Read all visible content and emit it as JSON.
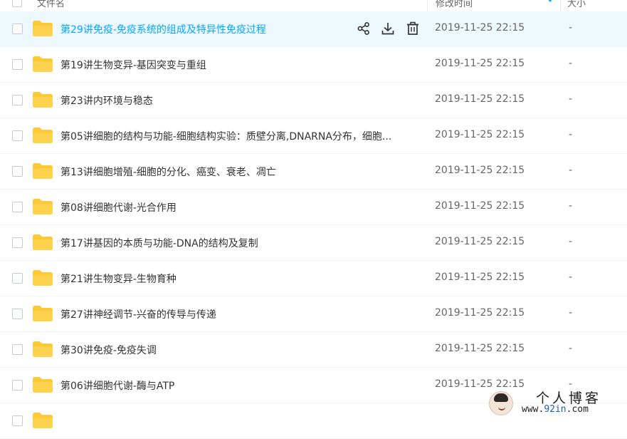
{
  "header": {
    "name_label": "文件名",
    "time_label": "修改时间",
    "size_label": "大小"
  },
  "rows": [
    {
      "name": "第29讲免疫-免疫系统的组成及特异性免疫过程",
      "time": "2019-11-25 22:15",
      "size": "-"
    },
    {
      "name": "第19讲生物变异-基因突变与重组",
      "time": "2019-11-25 22:15",
      "size": "-"
    },
    {
      "name": "第23讲内环境与稳态",
      "time": "2019-11-25 22:15",
      "size": "-"
    },
    {
      "name": "第05讲细胞的结构与功能-细胞结构实验：质壁分离,DNARNA分布，细胞...",
      "time": "2019-11-25 22:15",
      "size": "-"
    },
    {
      "name": "第13讲细胞增殖-细胞的分化、癌变、衰老、凋亡",
      "time": "2019-11-25 22:15",
      "size": "-"
    },
    {
      "name": "第08讲细胞代谢-光合作用",
      "time": "2019-11-25 22:15",
      "size": "-"
    },
    {
      "name": "第17讲基因的本质与功能-DNA的结构及复制",
      "time": "2019-11-25 22:15",
      "size": "-"
    },
    {
      "name": "第21讲生物变异-生物育种",
      "time": "2019-11-25 22:15",
      "size": "-"
    },
    {
      "name": "第27讲神经调节-兴奋的传导与传递",
      "time": "2019-11-25 22:15",
      "size": "-"
    },
    {
      "name": "第30讲免疫-免疫失调",
      "time": "2019-11-25 22:15",
      "size": "-"
    },
    {
      "name": "第06讲细胞代谢-酶与ATP",
      "time": "2019-11-25 22:15",
      "size": "-"
    }
  ],
  "actions": {
    "share_icon": "share-icon",
    "download_icon": "download-icon",
    "delete_icon": "trash-icon"
  },
  "watermark": {
    "title": "个人博客",
    "url_prefix": "www.",
    "url_brand": "92in",
    "url_suffix": ".com"
  },
  "colors": {
    "accent": "#06a7ff",
    "folder": "#ffc933",
    "active_row": "#eef8ff"
  }
}
